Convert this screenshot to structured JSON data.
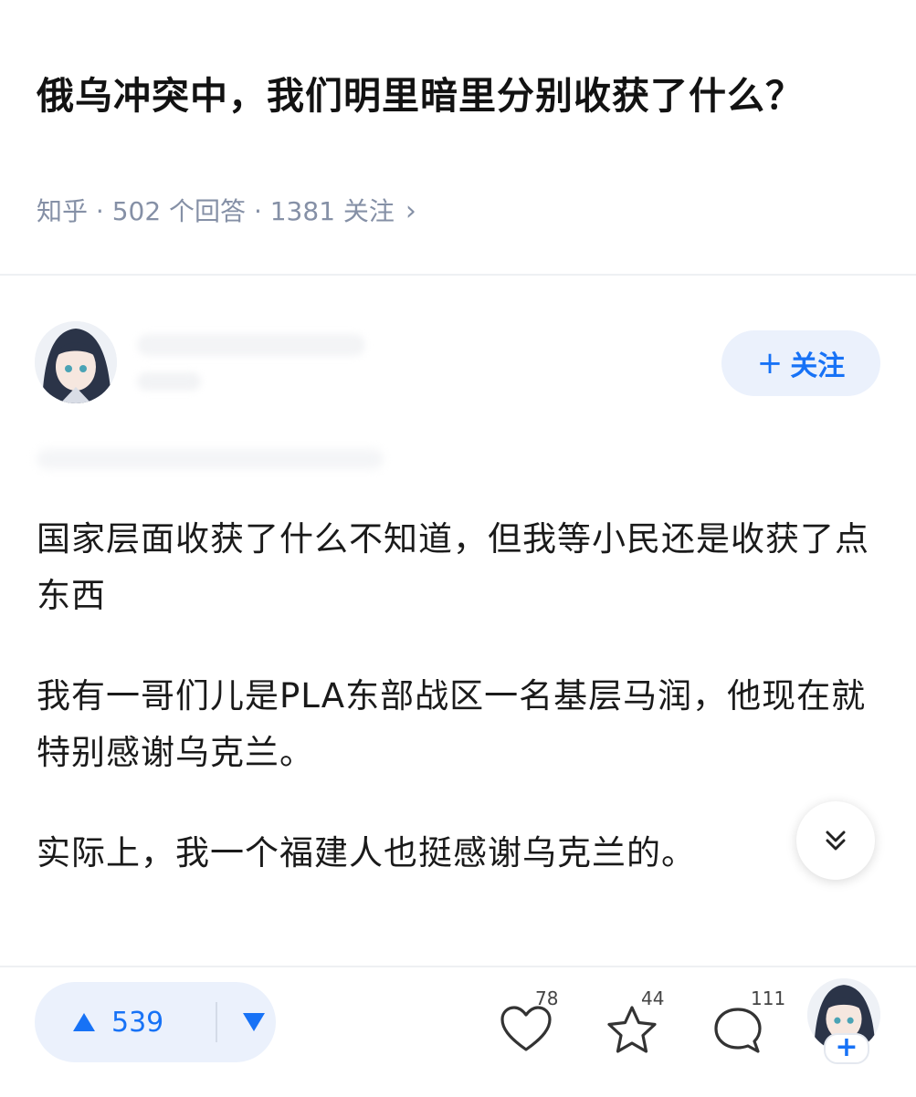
{
  "question": {
    "title": "俄乌冲突中，我们明里暗里分别收获了什么？",
    "meta": "知乎 · 502 个回答 · 1381 关注"
  },
  "author": {
    "follow_label": "关注"
  },
  "answer": {
    "paragraphs": [
      "国家层面收获了什么不知道，但我等小民还是收获了点东西",
      "我有一哥们儿是PLA东部战区一名基层马润，他现在就特别感谢乌克兰。",
      "实际上，我一个福建人也挺感谢乌克兰的。"
    ]
  },
  "actions": {
    "upvotes": "539",
    "likes": "78",
    "favorites": "44",
    "comments": "111"
  },
  "colors": {
    "accent": "#1772f6",
    "accent_bg": "#ebf1fc",
    "meta_gray": "#8590a6"
  },
  "icons": [
    "chevron-right-icon",
    "plus-icon",
    "double-chevron-down-icon",
    "triangle-up-icon",
    "triangle-down-icon",
    "heart-icon",
    "star-icon",
    "comment-icon"
  ]
}
